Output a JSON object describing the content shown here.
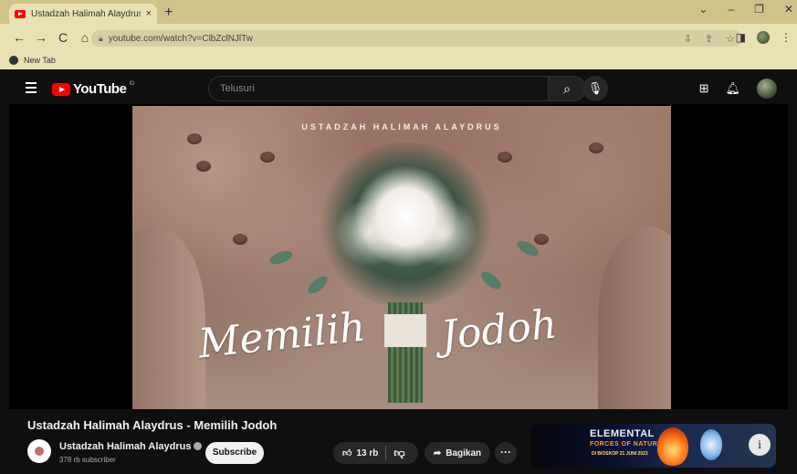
{
  "browser": {
    "tab_title": "Ustadzah Halimah Alaydrus - Me",
    "tab_close": "×",
    "new_tab": "+",
    "window_controls": [
      "⌄",
      "–",
      "❐",
      "✕"
    ],
    "url": "youtube.com/watch?v=ClbZclNJlTw",
    "bookmark": "New Tab"
  },
  "youtube": {
    "logo_text": "YouTube",
    "country_code": "ID",
    "search_placeholder": "Telusuri"
  },
  "thumbnail": {
    "top_text": "USTADZAH HALIMAH ALAYDRUS",
    "script_left": "Memilih",
    "script_right": "Jodoh"
  },
  "video": {
    "title": "Ustadzah Halimah Alaydrus - Memilih Jodoh",
    "channel_name": "Ustadzah Halimah Alaydrus",
    "subscriber_count": "378 rb subscriber",
    "subscribe_label": "Subscribe",
    "like_count": "13 rb",
    "share_label": "Bagikan",
    "more_label": "···"
  },
  "ad": {
    "title_line1": "ELEMENTAL",
    "title_line2": "FORCES OF NATURE",
    "subtitle": "DI BIOSKOP 21 JUNI 2023",
    "info_label": "i"
  },
  "colors": {
    "chrome_tabbar": "#cfc38a",
    "chrome_toolbar": "#e9e0b4",
    "yt_background": "#0f0f0f",
    "yt_red": "#ff0000"
  },
  "icons": [
    "youtube-favicon-icon",
    "back-icon",
    "forward-icon",
    "reload-icon",
    "home-icon",
    "lock-icon",
    "install-icon",
    "share-icon",
    "star-icon",
    "sidepanel-icon",
    "menu-icon",
    "globe-icon",
    "hamburger-icon",
    "search-icon",
    "mic-icon",
    "create-icon",
    "bell-icon",
    "verified-icon",
    "thumbs-up-icon",
    "thumbs-down-icon",
    "share-arrow-icon",
    "info-icon"
  ]
}
